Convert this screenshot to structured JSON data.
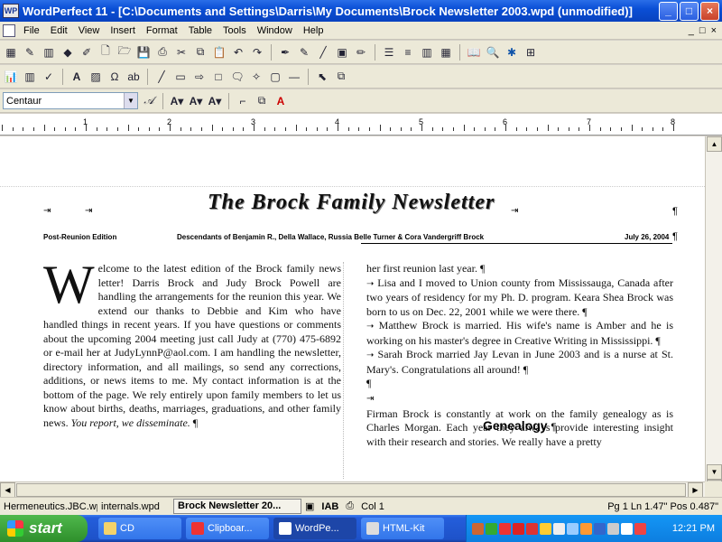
{
  "window": {
    "title": "WordPerfect 11 - [C:\\Documents and Settings\\Darris\\My Documents\\Brock Newsletter 2003.wpd (unmodified)]",
    "app_icon": "WP",
    "minimize": "_",
    "maximize": "□",
    "close": "×"
  },
  "menu": {
    "items": [
      "File",
      "Edit",
      "View",
      "Insert",
      "Format",
      "Table",
      "Tools",
      "Window",
      "Help"
    ],
    "doc_controls": [
      "_",
      "□",
      "×"
    ]
  },
  "toolbar3": {
    "font_name": "Centaur"
  },
  "ruler": {
    "numbers": [
      "1",
      "2",
      "3",
      "4",
      "5",
      "6",
      "7",
      "8"
    ]
  },
  "newsletter": {
    "masthead": "The Brock Family Newsletter",
    "edition": "Post-Reunion Edition",
    "descendants": "Descendants of Benjamin R., Della Wallace, Russia Belle Turner & Cora Vandergriff Brock",
    "date": "July 26, 2004",
    "dropcap": "W",
    "left_column": "elcome to the latest edition of the Brock family news letter! Darris Brock and Judy Brock Powell are handling the arrangements for the reunion this year. We extend our thanks to Debbie and Kim who have handled things in recent years. If you have questions or comments about the upcoming 2004 meeting just call Judy at (770) 475-6892 or e-mail her at JudyLynnP@aol.com. I am handling the newsletter, directory information, and all mailings, so send any corrections, additions, or news items to me. My contact information is at the bottom of the page. We rely entirely upon family members to let us know about births, deaths, marriages, graduations, and other family news.",
    "left_column_italic": "You report, we disseminate.",
    "right_top": "her first reunion last year.",
    "para1": "Lisa and I moved to Union county from Mississauga, Canada after two years of residency for my Ph. D. program. Keara Shea Brock was born to us on Dec. 22, 2001 while we were there.",
    "para2": "Matthew Brock is married. His wife's name is Amber and he is working on his master's degree in Creative Writing in Mississippi.",
    "para3": "Sarah Brock married Jay Levan in June 2003 and is a nurse at St. Mary's. Congratulations all around!",
    "genealogy_heading": "Genealogy",
    "genealogy_text": "Firman Brock is constantly at work on the family genealogy as is Charles Morgan. Each year they always provide interesting insight with their research and stories. We really have a pretty",
    "pilcrow": "¶"
  },
  "status": {
    "doc1": "Hermeneutics.JBC.wpd",
    "doc2": "internals.wpd",
    "doc3": "Brock Newsletter 20...",
    "ab": "AB",
    "col": "Col 1",
    "position": "Pg 1 Ln 1.47\" Pos 0.487\""
  },
  "taskbar": {
    "start": "start",
    "tasks": [
      "CD",
      "Clipboar...",
      "WordPe...",
      "HTML-Kit"
    ],
    "clock": "12:21 PM"
  },
  "colors": {
    "title_blue": "#0a4fd6",
    "start_green": "#3c9a38",
    "taskbar_blue": "#245edb"
  }
}
